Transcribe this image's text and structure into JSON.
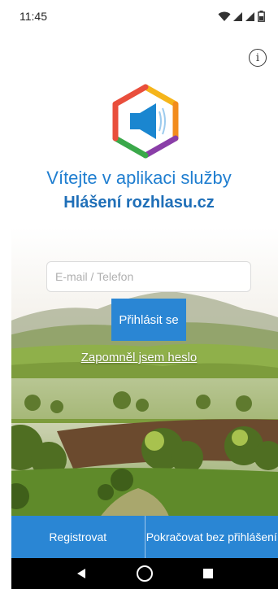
{
  "status_bar": {
    "time": "11:45",
    "icons": [
      "wifi-icon",
      "signal-icon",
      "signal-icon",
      "battery-icon"
    ]
  },
  "info": {
    "icon": "info-icon",
    "glyph": "i"
  },
  "logo": {
    "icon": "speaker-hexagon-logo",
    "colors": [
      "#f5b51b",
      "#e94e3c",
      "#3aa84a",
      "#1a86d0",
      "#8a3ea8",
      "#f28c1d"
    ]
  },
  "header": {
    "welcome": "Vítejte v aplikaci služby",
    "brand": "Hlášení rozhlasu.cz"
  },
  "login": {
    "placeholder": "E-mail / Telefon",
    "value": "",
    "submit_label": "Přihlásit se",
    "forgot_label": "Zapomněl jsem heslo"
  },
  "bottom_actions": {
    "register_label": "Registrovat",
    "continue_label": "Pokračovat bez přihlášení"
  },
  "nav_bar": {
    "back_icon": "back-triangle-icon",
    "home_icon": "home-circle-icon",
    "recents_icon": "recents-square-icon"
  },
  "colors": {
    "primary": "#2a86d4",
    "title": "#1f7ed0",
    "brand": "#1f6fb8"
  }
}
